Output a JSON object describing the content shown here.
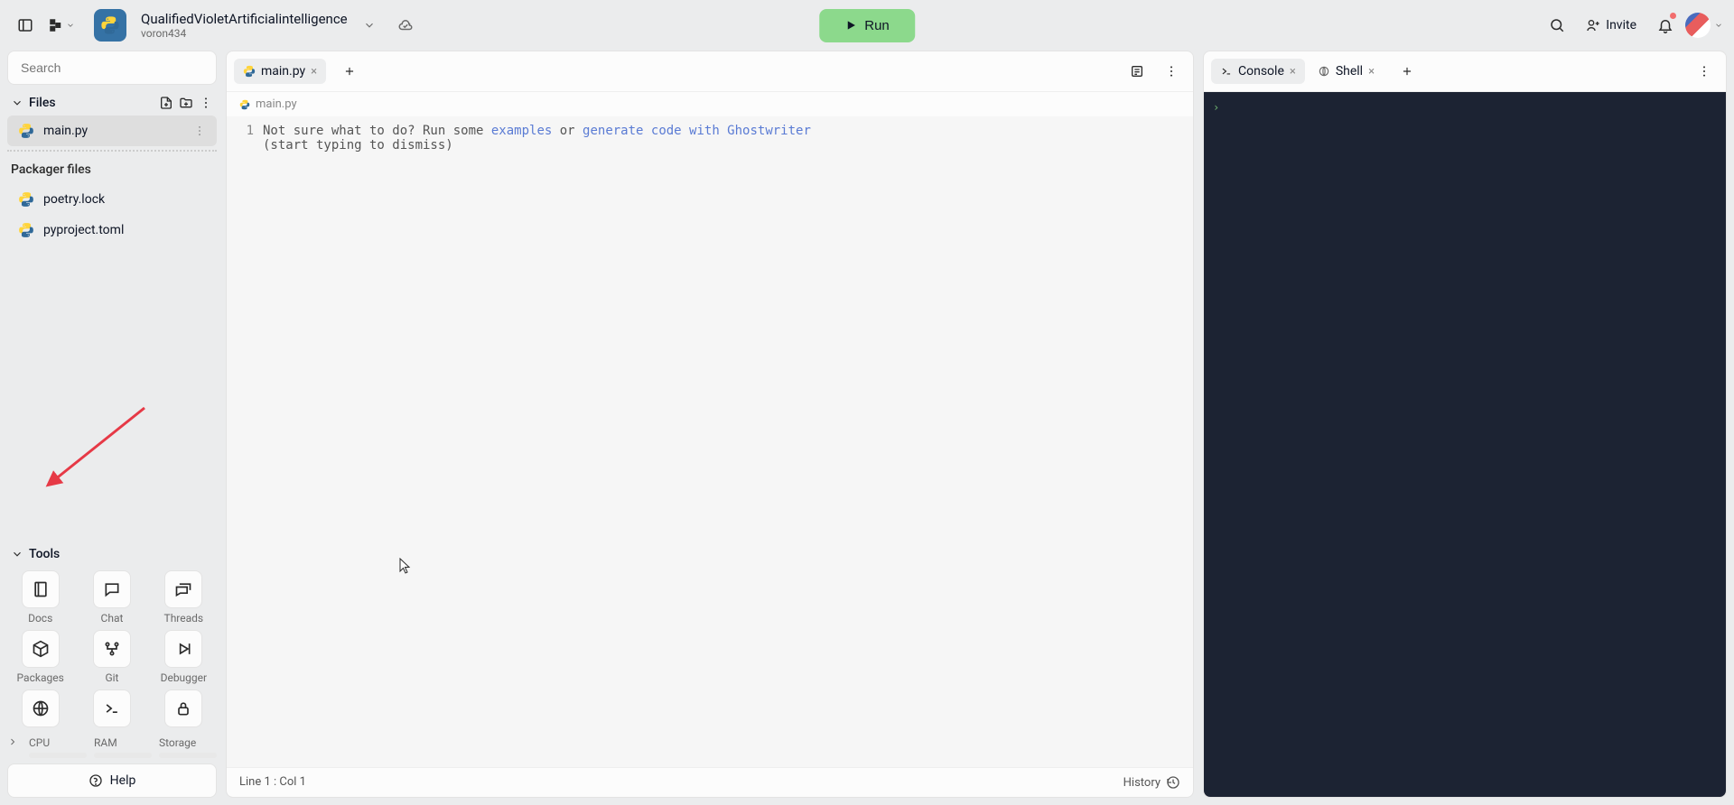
{
  "header": {
    "title": "QualifiedVioletArtificialintelligence",
    "subtitle": "voron434",
    "run_label": "Run",
    "invite_label": "Invite"
  },
  "sidebar": {
    "search_placeholder": "Search",
    "files_label": "Files",
    "files": [
      {
        "name": "main.py",
        "active": true
      }
    ],
    "packager_label": "Packager files",
    "packager_files": [
      {
        "name": "poetry.lock"
      },
      {
        "name": "pyproject.toml"
      }
    ],
    "tools_label": "Tools",
    "tools": [
      {
        "label": "Docs"
      },
      {
        "label": "Chat"
      },
      {
        "label": "Threads"
      },
      {
        "label": "Packages"
      },
      {
        "label": "Git"
      },
      {
        "label": "Debugger"
      }
    ],
    "resources": {
      "cpu": "CPU",
      "ram": "RAM",
      "storage": "Storage"
    },
    "help_label": "Help"
  },
  "editor": {
    "tab_label": "main.py",
    "breadcrumb": "main.py",
    "line_number": "1",
    "placeholder_prefix": "Not sure what to do? Run some ",
    "placeholder_examples": "examples",
    "placeholder_or": " or ",
    "placeholder_ghostwriter": "generate code with Ghostwriter",
    "placeholder_suffix": "(start typing to dismiss)",
    "status_line": "Line 1 : Col 1",
    "history_label": "History"
  },
  "right": {
    "console_tab": "Console",
    "shell_tab": "Shell",
    "prompt": "›"
  }
}
